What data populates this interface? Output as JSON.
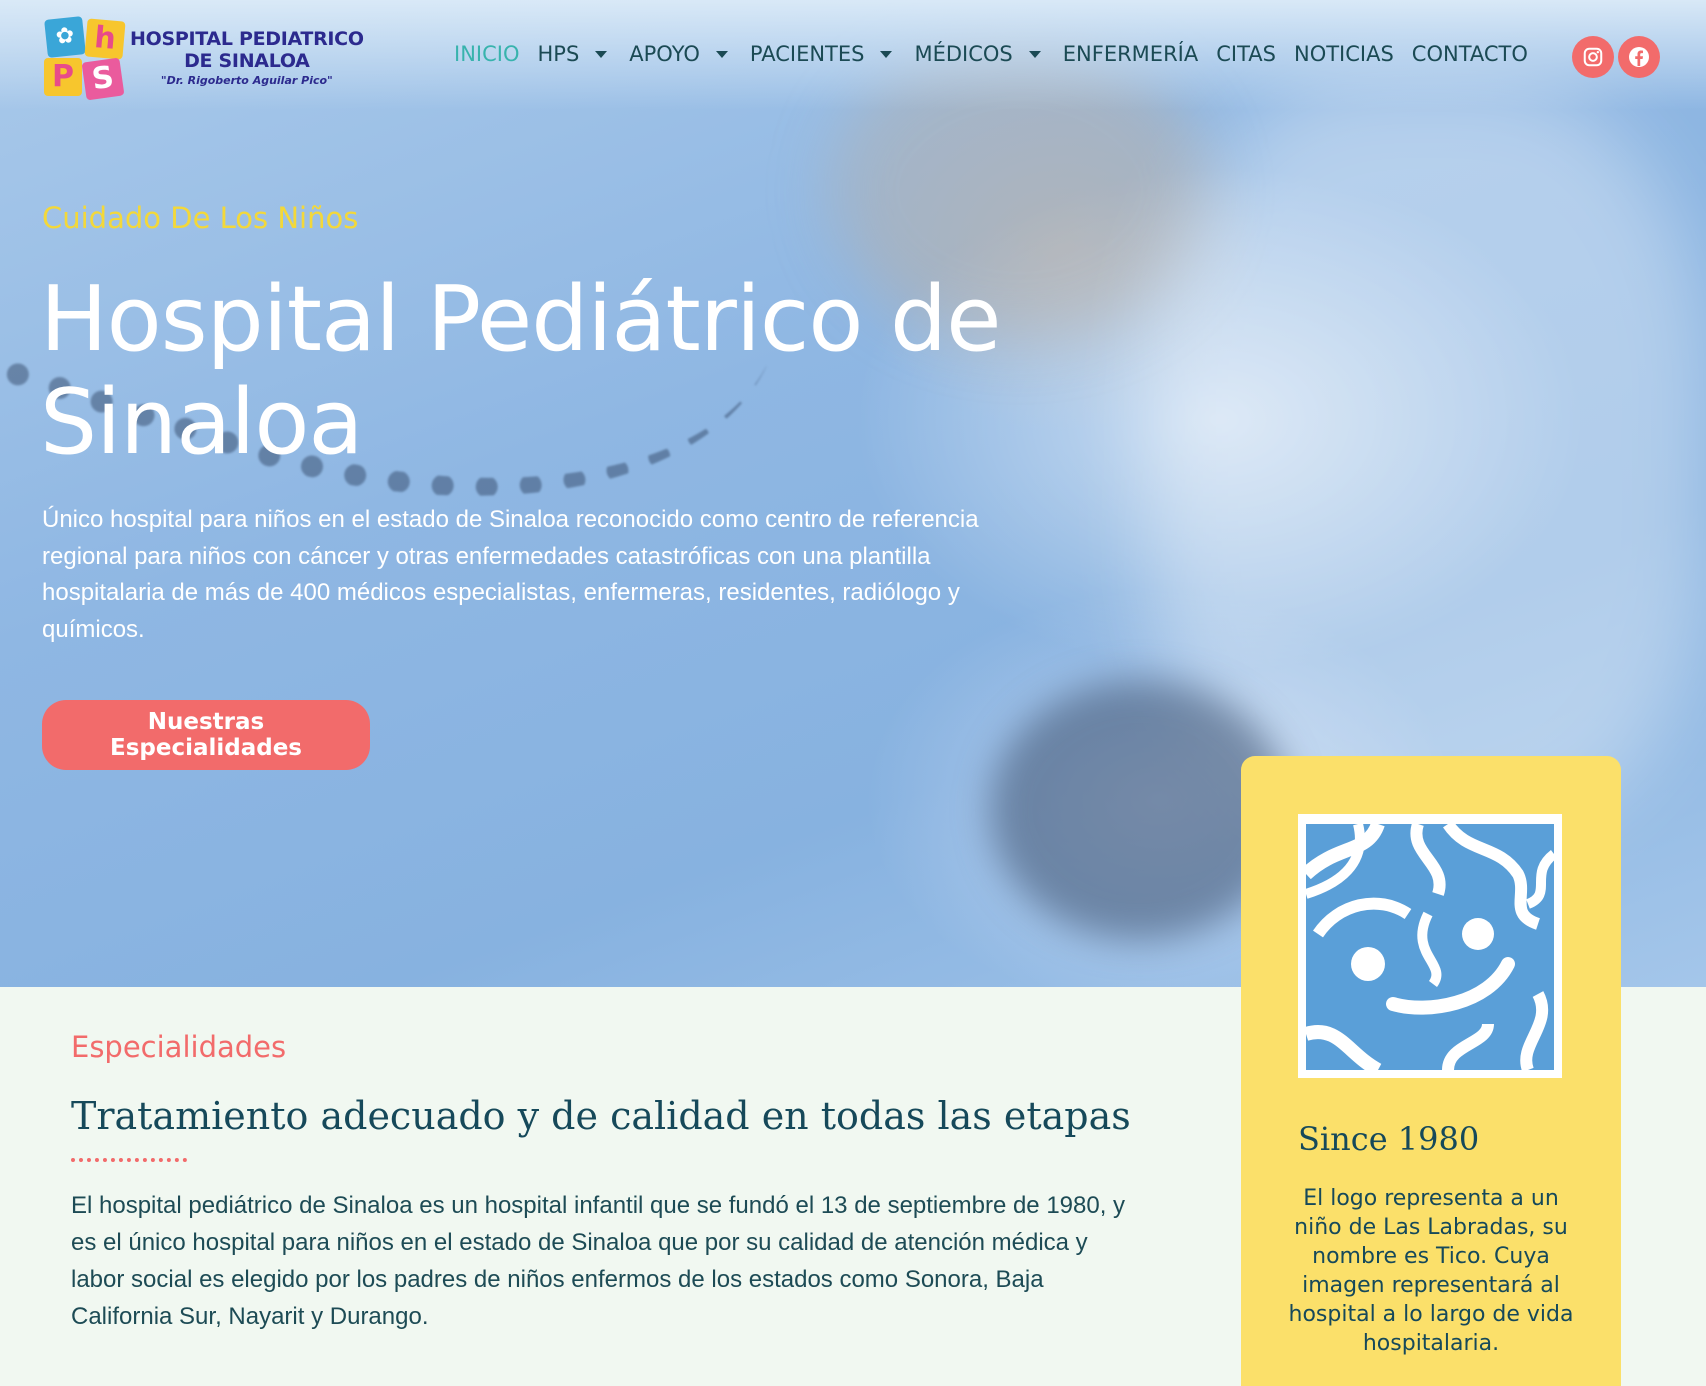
{
  "header": {
    "logo": {
      "blocks": [
        "h",
        "P",
        "S"
      ],
      "line1": "HOSPITAL PEDIATRICO",
      "line2": "DE SINALOA",
      "line3": "\"Dr. Rigoberto Aguilar Pico\""
    },
    "nav": [
      {
        "label": "INICIO",
        "active": true,
        "dropdown": false
      },
      {
        "label": "HPS",
        "active": false,
        "dropdown": true
      },
      {
        "label": "APOYO",
        "active": false,
        "dropdown": true
      },
      {
        "label": "PACIENTES",
        "active": false,
        "dropdown": true
      },
      {
        "label": "MÉDICOS",
        "active": false,
        "dropdown": true
      },
      {
        "label": "ENFERMERÍA",
        "active": false,
        "dropdown": false
      },
      {
        "label": "CITAS",
        "active": false,
        "dropdown": false
      },
      {
        "label": "NOTICIAS",
        "active": false,
        "dropdown": false
      },
      {
        "label": "CONTACTO",
        "active": false,
        "dropdown": false
      }
    ],
    "social": [
      {
        "icon": "instagram-icon",
        "color": "#f26b6b"
      },
      {
        "icon": "facebook-icon",
        "color": "#f26b6b"
      }
    ]
  },
  "hero": {
    "kicker": "Cuidado De Los Niños",
    "title_line1": "Hospital Pediátrico de",
    "title_line2": "Sinaloa",
    "description": "Único hospital para niños en el estado de Sinaloa reconocido como centro de referencia regional para niños con cáncer y otras enfermedades catastróficas con una plantilla hospitalaria de más de 400 médicos especialistas, enfermeras, residentes, radiólogo y químicos.",
    "button_label": "Nuestras Especialidades"
  },
  "section": {
    "kicker": "Especialidades",
    "title": "Tratamiento adecuado y de calidad en todas las etapas",
    "body": "El hospital pediátrico de Sinaloa es un hospital infantil que se fundó el 13 de septiembre de 1980, y es el único hospital para niños en el estado de Sinaloa que por su calidad de atención médica y labor social es elegido por los padres de niños enfermos de los estados como Sonora, Baja California Sur, Nayarit y Durango."
  },
  "card": {
    "logo_icon": "tico-logo-icon",
    "title": "Since 1980",
    "body": "El logo representa a un niño de Las Labradas, su nombre es Tico. Cuya imagen representará al hospital a lo largo de vida hospitalaria."
  },
  "colors": {
    "accent_coral": "#f26b6b",
    "accent_yellow": "#fbe06a",
    "nav_active": "#38b3ad",
    "dark_teal": "#16495a",
    "logo_blue": "#5a9fd8"
  }
}
